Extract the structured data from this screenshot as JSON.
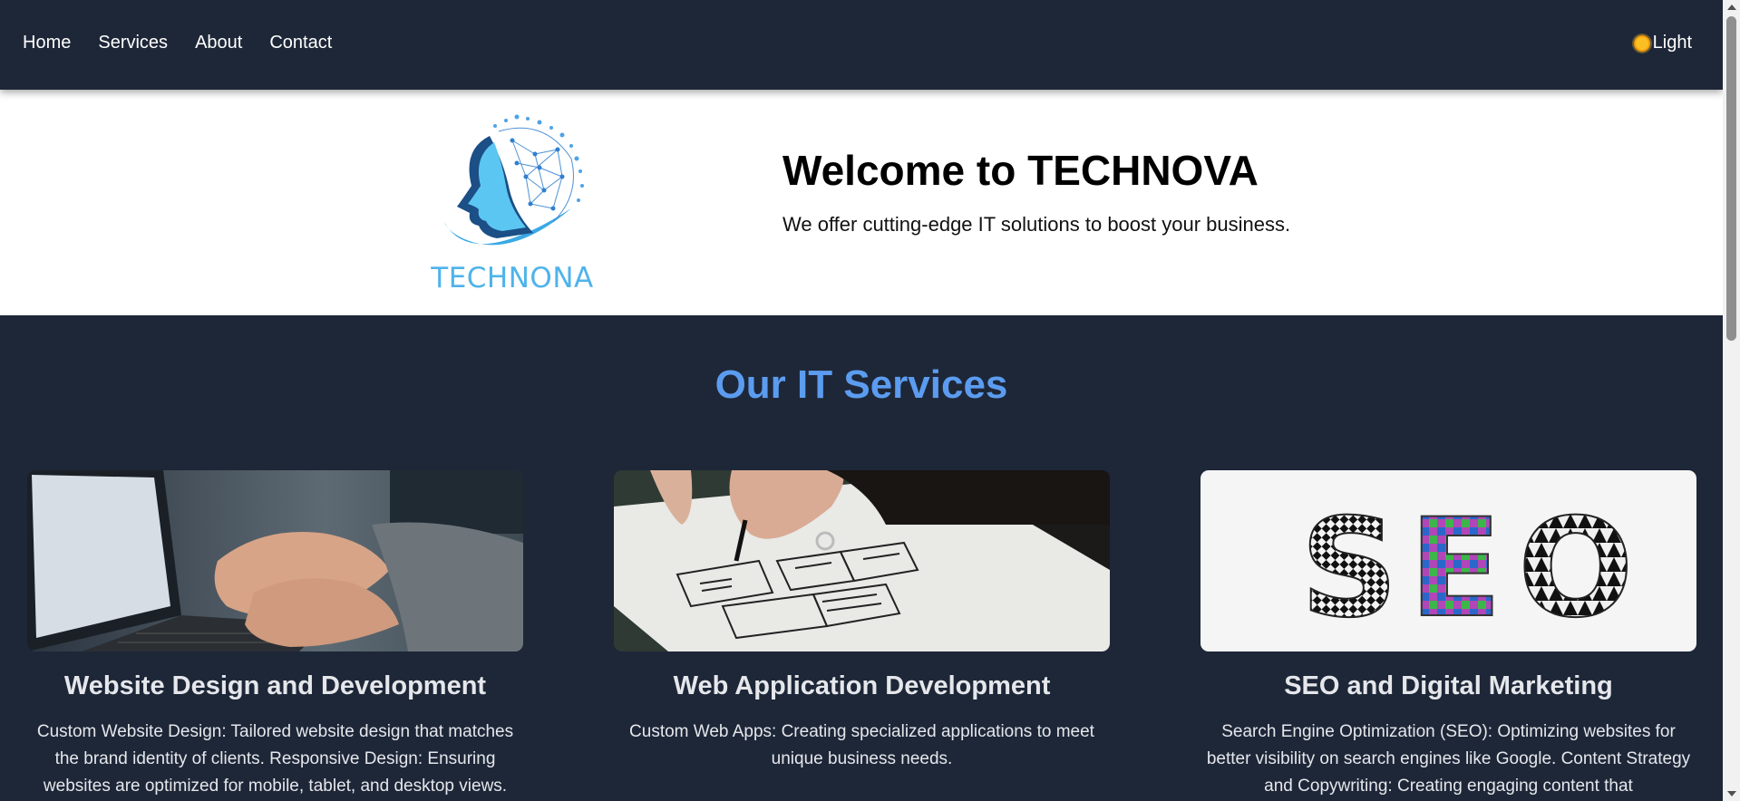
{
  "nav": {
    "links": [
      "Home",
      "Services",
      "About",
      "Contact"
    ],
    "theme_toggle_label": "Light",
    "theme_icon": "sun-icon"
  },
  "hero": {
    "logo_text": "TECHNONA",
    "title": "Welcome to TECHNOVA",
    "subtitle": "We offer cutting-edge IT solutions to boost your business."
  },
  "services": {
    "heading": "Our IT Services",
    "cards": [
      {
        "title": "Website Design and Development",
        "description": "Custom Website Design: Tailored website design that matches the brand identity of clients. Responsive Design: Ensuring websites are optimized for mobile, tablet, and desktop views.",
        "image": "laptop-typing-photo"
      },
      {
        "title": "Web Application Development",
        "description": "Custom Web Apps: Creating specialized applications to meet unique business needs.",
        "image": "wireframe-sketch-photo"
      },
      {
        "title": "SEO and Digital Marketing",
        "description": "Search Engine Optimization (SEO): Optimizing websites for better visibility on search engines like Google. Content Strategy and Copywriting: Creating engaging content that",
        "image": "seo-letters-photo"
      }
    ]
  },
  "colors": {
    "nav_bg": "#1e2738",
    "page_bg": "#1e2738",
    "hero_bg": "#ffffff",
    "accent": "#5b9cf0",
    "logo_blue": "#4fb3ea"
  }
}
